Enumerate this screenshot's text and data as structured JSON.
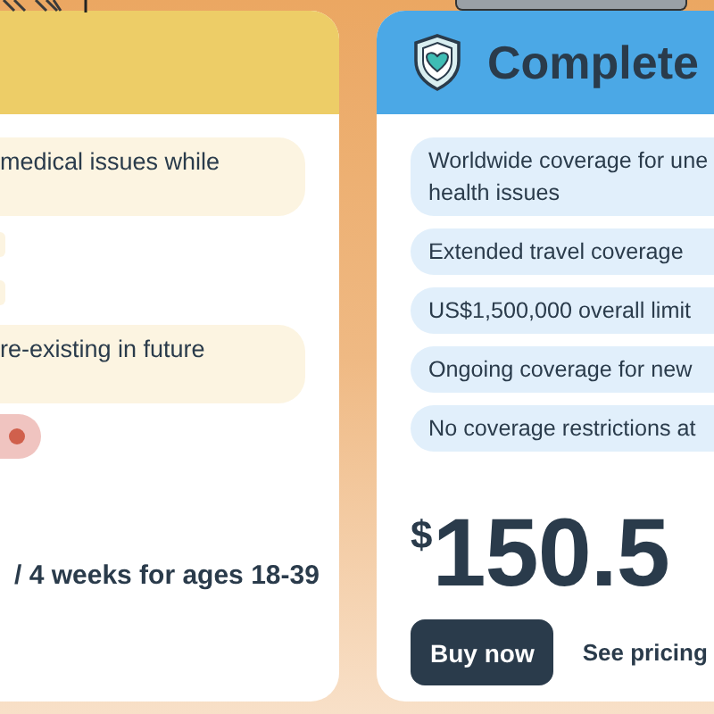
{
  "plans": [
    {
      "kind": "partial",
      "features": [
        {
          "kind": "wrapped",
          "lines": [
            "medical issues while"
          ]
        },
        {
          "kind": "sliver"
        },
        {
          "kind": "sliver"
        },
        {
          "kind": "wrapped",
          "lines": [
            "re-existing in future"
          ]
        },
        {
          "kind": "alert"
        }
      ],
      "price_note": "/ 4 weeks for ages 18-39"
    },
    {
      "kind": "full",
      "title": "Complete",
      "features": [
        {
          "kind": "text",
          "lines": [
            "Worldwide coverage for une",
            "health issues"
          ]
        },
        {
          "kind": "text",
          "lines": [
            "Extended travel coverage"
          ]
        },
        {
          "kind": "text",
          "lines": [
            "US$1,500,000 overall limit"
          ]
        },
        {
          "kind": "text",
          "lines": [
            "Ongoing coverage for new"
          ]
        },
        {
          "kind": "text",
          "lines": [
            "No coverage restrictions at"
          ]
        }
      ],
      "price": {
        "currency": "$",
        "amount": "150.5"
      },
      "buy_button": "Buy now",
      "pricing_link": "See pricing"
    }
  ]
}
